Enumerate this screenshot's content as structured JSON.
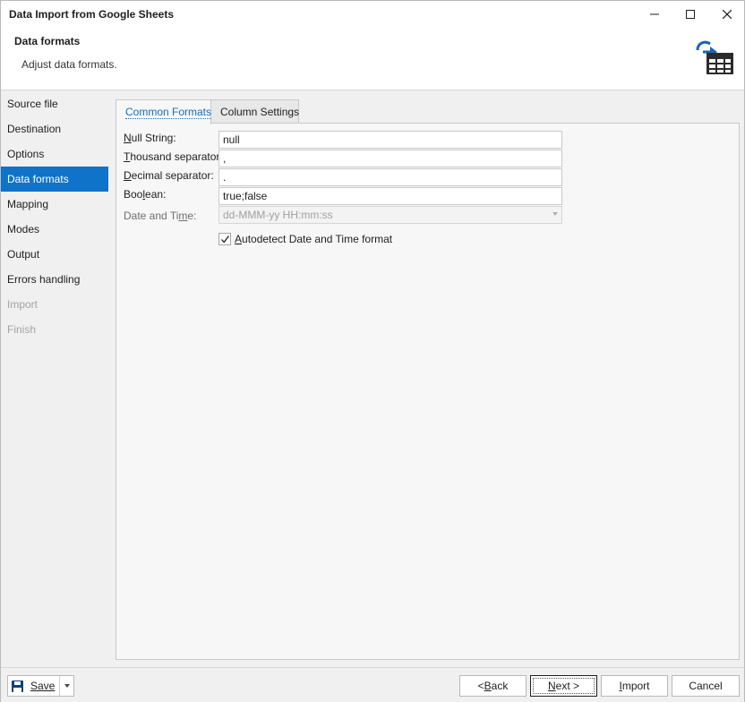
{
  "window": {
    "title": "Data Import from Google Sheets"
  },
  "header": {
    "title": "Data formats",
    "subtitle": "Adjust data formats.",
    "icon": "table-import-icon"
  },
  "sidebar": {
    "items": [
      {
        "label": "Source file",
        "state": "normal"
      },
      {
        "label": "Destination",
        "state": "normal"
      },
      {
        "label": "Options",
        "state": "normal"
      },
      {
        "label": "Data formats",
        "state": "active"
      },
      {
        "label": "Mapping",
        "state": "normal"
      },
      {
        "label": "Modes",
        "state": "normal"
      },
      {
        "label": "Output",
        "state": "normal"
      },
      {
        "label": "Errors handling",
        "state": "normal"
      },
      {
        "label": "Import",
        "state": "disabled"
      },
      {
        "label": "Finish",
        "state": "disabled"
      }
    ]
  },
  "tabs": [
    {
      "label": "Common Formats",
      "active": true
    },
    {
      "label": "Column Settings",
      "active": false
    }
  ],
  "form": {
    "null_string": {
      "pre": "",
      "key": "N",
      "post": "ull String:",
      "value": "null"
    },
    "thousand_separator": {
      "pre": "",
      "key": "T",
      "post": "housand separator:",
      "value": ","
    },
    "decimal_separator": {
      "pre": "",
      "key": "D",
      "post": "ecimal separator:",
      "value": "."
    },
    "boolean": {
      "pre": "Boo",
      "key": "l",
      "post": "ean:",
      "value": "true;false"
    },
    "date_time": {
      "pre": "Date and Ti",
      "key": "m",
      "post": "e:",
      "value": "dd-MMM-yy HH:mm:ss"
    },
    "autodetect": {
      "pre": "",
      "key": "A",
      "post": "utodetect Date and Time format",
      "checked": true
    }
  },
  "footer": {
    "save": "Save",
    "back": {
      "pre": "< ",
      "key": "B",
      "post": "ack"
    },
    "next": {
      "pre": "",
      "key": "N",
      "post": "ext >"
    },
    "import": {
      "pre": "",
      "key": "I",
      "post": "mport"
    },
    "cancel": "Cancel"
  },
  "colors": {
    "accent": "#0e73c9",
    "active_tab_text": "#0e6fc7",
    "disabled_text": "#a3a3a3"
  }
}
